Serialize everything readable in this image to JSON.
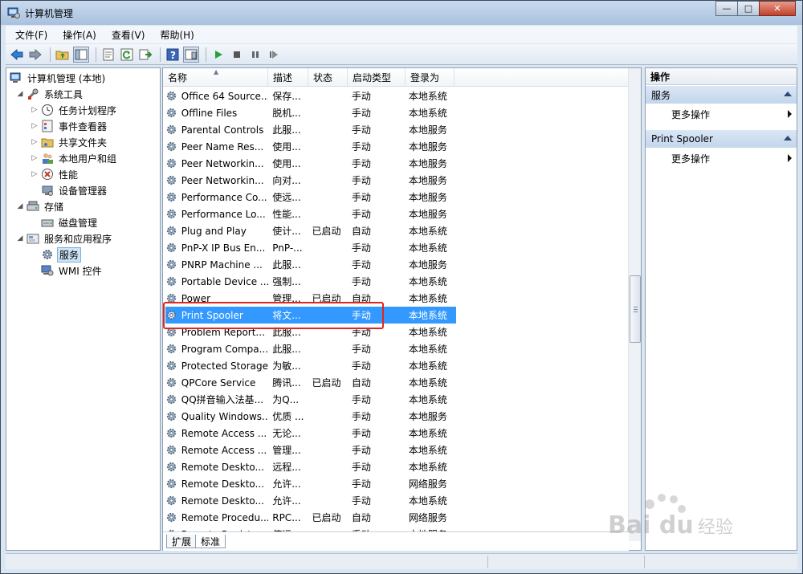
{
  "window": {
    "title": "计算机管理",
    "buttons": {
      "minimize": "—",
      "maximize": "□",
      "close": "✕"
    }
  },
  "menu": [
    "文件(F)",
    "操作(A)",
    "查看(V)",
    "帮助(H)"
  ],
  "toolbar": {
    "icons": [
      "back-icon",
      "forward-icon",
      "up-folder-icon",
      "show-tree-icon",
      "properties-icon",
      "refresh-icon",
      "export-icon",
      "help-icon",
      "console-view-icon",
      "start-service-icon",
      "stop-service-icon",
      "pause-service-icon",
      "restart-service-icon"
    ]
  },
  "tree": [
    {
      "label": "计算机管理 (本地)",
      "depth": 0,
      "expander": "",
      "icon": "computer-icon"
    },
    {
      "label": "系统工具",
      "depth": 1,
      "expander": "◢",
      "icon": "tools-icon"
    },
    {
      "label": "任务计划程序",
      "depth": 2,
      "expander": "▷",
      "icon": "clock-icon"
    },
    {
      "label": "事件查看器",
      "depth": 2,
      "expander": "▷",
      "icon": "event-viewer-icon"
    },
    {
      "label": "共享文件夹",
      "depth": 2,
      "expander": "▷",
      "icon": "shared-folder-icon"
    },
    {
      "label": "本地用户和组",
      "depth": 2,
      "expander": "▷",
      "icon": "users-icon"
    },
    {
      "label": "性能",
      "depth": 2,
      "expander": "▷",
      "icon": "performance-icon"
    },
    {
      "label": "设备管理器",
      "depth": 2,
      "expander": "",
      "icon": "device-manager-icon"
    },
    {
      "label": "存储",
      "depth": 1,
      "expander": "◢",
      "icon": "storage-icon"
    },
    {
      "label": "磁盘管理",
      "depth": 2,
      "expander": "",
      "icon": "disk-icon"
    },
    {
      "label": "服务和应用程序",
      "depth": 1,
      "expander": "◢",
      "icon": "services-apps-icon"
    },
    {
      "label": "服务",
      "depth": 2,
      "expander": "",
      "icon": "gear-icon",
      "selected": true
    },
    {
      "label": "WMI 控件",
      "depth": 2,
      "expander": "",
      "icon": "wmi-icon"
    }
  ],
  "list": {
    "columns": {
      "name": "名称",
      "desc": "描述",
      "status": "状态",
      "startup": "启动类型",
      "logon": "登录为"
    },
    "rows": [
      {
        "name": "Office 64 Source...",
        "desc": "保存...",
        "status": "",
        "startup": "手动",
        "logon": "本地系统"
      },
      {
        "name": "Offline Files",
        "desc": "脱机...",
        "status": "",
        "startup": "手动",
        "logon": "本地系统"
      },
      {
        "name": "Parental Controls",
        "desc": "此服...",
        "status": "",
        "startup": "手动",
        "logon": "本地服务"
      },
      {
        "name": "Peer Name Res...",
        "desc": "使用...",
        "status": "",
        "startup": "手动",
        "logon": "本地服务"
      },
      {
        "name": "Peer Networkin...",
        "desc": "使用...",
        "status": "",
        "startup": "手动",
        "logon": "本地服务"
      },
      {
        "name": "Peer Networkin...",
        "desc": "向对...",
        "status": "",
        "startup": "手动",
        "logon": "本地服务"
      },
      {
        "name": "Performance Co...",
        "desc": "使远...",
        "status": "",
        "startup": "手动",
        "logon": "本地服务"
      },
      {
        "name": "Performance Lo...",
        "desc": "性能...",
        "status": "",
        "startup": "手动",
        "logon": "本地服务"
      },
      {
        "name": "Plug and Play",
        "desc": "使计...",
        "status": "已启动",
        "startup": "自动",
        "logon": "本地系统"
      },
      {
        "name": "PnP-X IP Bus En...",
        "desc": "PnP-...",
        "status": "",
        "startup": "手动",
        "logon": "本地系统"
      },
      {
        "name": "PNRP Machine ...",
        "desc": "此服...",
        "status": "",
        "startup": "手动",
        "logon": "本地服务"
      },
      {
        "name": "Portable Device ...",
        "desc": "强制...",
        "status": "",
        "startup": "手动",
        "logon": "本地系统"
      },
      {
        "name": "Power",
        "desc": "管理...",
        "status": "已启动",
        "startup": "自动",
        "logon": "本地系统"
      },
      {
        "name": "Print Spooler",
        "desc": "将文...",
        "status": "",
        "startup": "手动",
        "logon": "本地系统",
        "selected": true
      },
      {
        "name": "Problem Report...",
        "desc": "此服...",
        "status": "",
        "startup": "手动",
        "logon": "本地系统"
      },
      {
        "name": "Program Compa...",
        "desc": "此服...",
        "status": "",
        "startup": "手动",
        "logon": "本地系统"
      },
      {
        "name": "Protected Storage",
        "desc": "为敏...",
        "status": "",
        "startup": "手动",
        "logon": "本地系统"
      },
      {
        "name": "QPCore Service",
        "desc": "腾讯...",
        "status": "已启动",
        "startup": "自动",
        "logon": "本地系统"
      },
      {
        "name": "QQ拼音输入法基...",
        "desc": "为Q...",
        "status": "",
        "startup": "手动",
        "logon": "本地系统"
      },
      {
        "name": "Quality Windows...",
        "desc": "优质 ...",
        "status": "",
        "startup": "手动",
        "logon": "本地服务"
      },
      {
        "name": "Remote Access ...",
        "desc": "无论...",
        "status": "",
        "startup": "手动",
        "logon": "本地系统"
      },
      {
        "name": "Remote Access ...",
        "desc": "管理...",
        "status": "",
        "startup": "手动",
        "logon": "本地系统"
      },
      {
        "name": "Remote Deskto...",
        "desc": "远程...",
        "status": "",
        "startup": "手动",
        "logon": "本地系统"
      },
      {
        "name": "Remote Deskto...",
        "desc": "允许...",
        "status": "",
        "startup": "手动",
        "logon": "网络服务"
      },
      {
        "name": "Remote Deskto...",
        "desc": "允许...",
        "status": "",
        "startup": "手动",
        "logon": "本地系统"
      },
      {
        "name": "Remote Procedu...",
        "desc": "RPC...",
        "status": "已启动",
        "startup": "自动",
        "logon": "网络服务"
      },
      {
        "name": "Remote Registry",
        "desc": "使远...",
        "status": "",
        "startup": "手动",
        "logon": "本地服务"
      }
    ],
    "tabs": [
      "扩展",
      "标准"
    ]
  },
  "actions": {
    "header": "操作",
    "groups": [
      {
        "title": "服务",
        "item": "更多操作"
      },
      {
        "title": "Print Spooler",
        "item": "更多操作"
      }
    ]
  },
  "colors": {
    "selection": "#3399ff",
    "highlight_box": "#e3261c",
    "tree_selection": "#cde3f6"
  }
}
